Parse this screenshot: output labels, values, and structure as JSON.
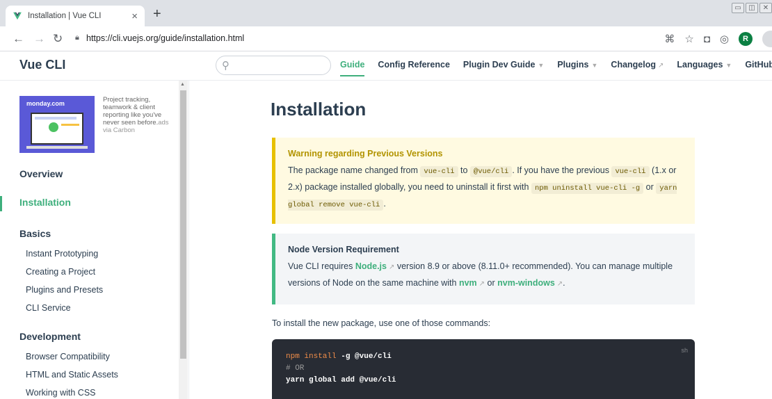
{
  "browser": {
    "tab_title": "Installation | Vue CLI",
    "tab_close": "×",
    "new_tab": "+",
    "url": "https://cli.vuejs.org/guide/installation.html",
    "avatar_initial": "R",
    "window_controls": [
      "▭",
      "◫",
      "✕"
    ]
  },
  "navbar": {
    "site_name": "Vue CLI",
    "search_placeholder": "",
    "links": [
      {
        "label": "Guide",
        "active": true
      },
      {
        "label": "Config Reference"
      },
      {
        "label": "Plugin Dev Guide",
        "dropdown": true
      },
      {
        "label": "Plugins",
        "dropdown": true
      },
      {
        "label": "Changelog",
        "external": true
      },
      {
        "label": "Languages",
        "dropdown": true
      },
      {
        "label": "GitHub",
        "external": true
      }
    ]
  },
  "ad": {
    "brand": "monday.com",
    "text": "Project tracking, teamwork & client reporting like you've never seen before.",
    "via": "ads via Carbon"
  },
  "sidebar": {
    "overview": "Overview",
    "installation": "Installation",
    "basics": "Basics",
    "basics_items": [
      "Instant Prototyping",
      "Creating a Project",
      "Plugins and Presets",
      "CLI Service"
    ],
    "development": "Development",
    "development_items": [
      "Browser Compatibility",
      "HTML and Static Assets",
      "Working with CSS"
    ]
  },
  "content": {
    "title": "Installation",
    "warning": {
      "title": "Warning regarding Previous Versions",
      "t1": "The package name changed from ",
      "c1": "vue-cli",
      "t2": " to ",
      "c2": "@vue/cli",
      "t3": ". If you have the previous ",
      "c3": "vue-cli",
      "t4": " (1.x or 2.x) package installed globally, you need to uninstall it first with ",
      "c4": "npm uninstall vue-cli -g",
      "t5": " or ",
      "c5": "yarn global remove vue-cli",
      "t6": "."
    },
    "node": {
      "title": "Node Version Requirement",
      "t1": "Vue CLI requires ",
      "l1": "Node.js",
      "t2": " version 8.9 or above (8.11.0+ recommended). You can manage multiple versions of Node on the same machine with ",
      "l2": "nvm",
      "t3": " or ",
      "l3": "nvm-windows",
      "t4": "."
    },
    "install_para": "To install the new package, use one of those commands:",
    "code": {
      "lang": "sh",
      "l1_kw": "npm install",
      "l1_rest": " -g ",
      "l1_pkg": "@vue/cli",
      "comment": "# OR",
      "l3": "yarn global add @vue/cli"
    }
  }
}
